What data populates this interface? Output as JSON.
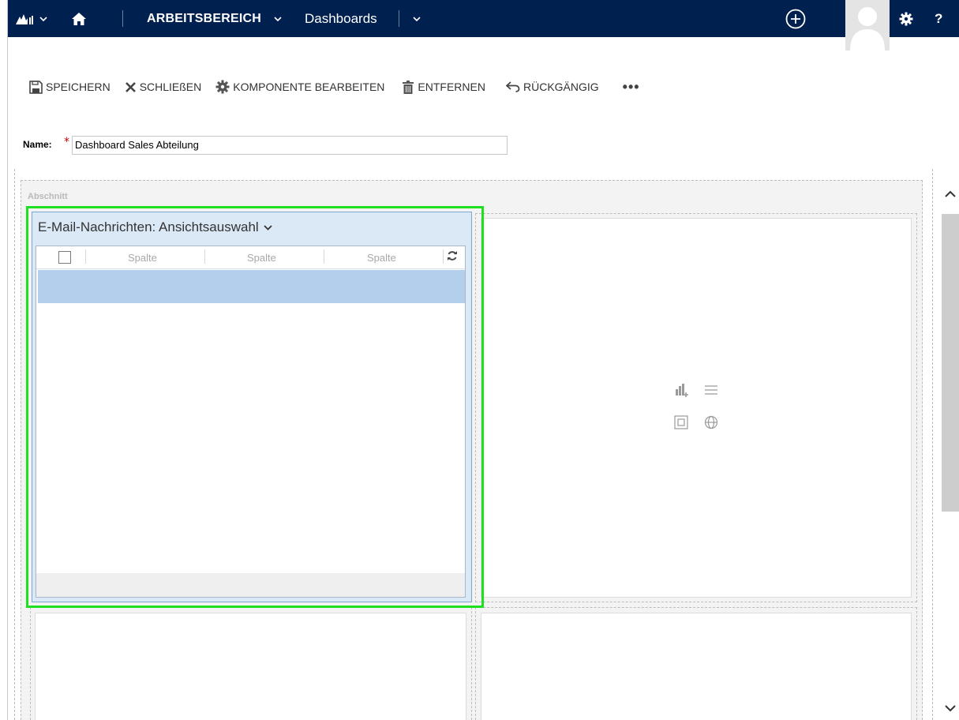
{
  "nav": {
    "workspace": "ARBEITSBEREICH",
    "area": "Dashboards",
    "help": "?",
    "colors": {
      "bar": "#002050",
      "text": "#ffffff"
    }
  },
  "toolbar": {
    "save": "SPEICHERN",
    "close": "SCHLIEßEN",
    "edit_component": "KOMPONENTE BEARBEITEN",
    "remove": "ENTFERNEN",
    "undo": "RÜCKGÄNGIG",
    "more": "•••"
  },
  "form": {
    "name_label": "Name:",
    "required_mark": "*",
    "name_value": "Dashboard Sales Abteilung"
  },
  "section": {
    "label": "Abschnitt"
  },
  "component": {
    "title": "E-Mail-Nachrichten: Ansichtsauswahl",
    "columns": [
      "Spalte",
      "Spalte",
      "Spalte"
    ],
    "highlight_color": "#1fe01f",
    "selected_row_color": "#b4cfec"
  },
  "icons": {
    "nav": [
      "dynamics-logo-icon",
      "home-icon",
      "new-plus-icon",
      "user-avatar-icon",
      "settings-gear-icon"
    ],
    "toolbar": [
      "save-icon",
      "close-icon",
      "gear-icon",
      "trash-icon",
      "undo-icon"
    ],
    "placeholder": [
      "add-chart-icon",
      "add-list-icon",
      "add-iframe-icon",
      "add-web-resource-icon"
    ]
  }
}
